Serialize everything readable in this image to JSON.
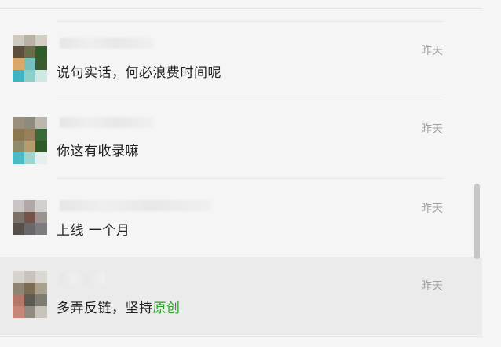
{
  "comments": [
    {
      "time": "昨天",
      "message": "说句实话，何必浪费时间呢",
      "avatar_colors": [
        "#cfcac0",
        "#b9b3a6",
        "#d3cfc4",
        "#5c4f3c",
        "#6a6d4a",
        "#2f5e2a",
        "#d8a96a",
        "#73c0bd",
        "#3c5a2f",
        "#3fb3c3",
        "#8cd0cb",
        "#cfe8e4"
      ]
    },
    {
      "time": "昨天",
      "message": "你这有收录嘛",
      "avatar_colors": [
        "#9a8f7e",
        "#8f8a7f",
        "#bdb6ac",
        "#8a7650",
        "#977f5c",
        "#3a6a3a",
        "#8e8a6c",
        "#b59c6d",
        "#2f5b2a",
        "#4bbac6",
        "#9fd4cf",
        "#e6efee"
      ]
    },
    {
      "time": "昨天",
      "message": "上线  一个月",
      "avatar_colors": [
        "#c9c5c4",
        "#b0a7a6",
        "#d2cfcf",
        "#7b7068",
        "#74534a",
        "#9a9390",
        "#55504c",
        "#6b6669",
        "#7d7a82",
        "#3d3d45",
        "#585566",
        "#8f8d97"
      ]
    },
    {
      "time": "昨天",
      "message": "多弄反链，坚持",
      "message_link": "原创",
      "avatar_colors": [
        "#d6d2cc",
        "#c9c3bb",
        "#dbd8d3",
        "#8f8374",
        "#7b6b55",
        "#a7a08e",
        "#b57868",
        "#5d5a52",
        "#7e7b70",
        "#c8857a",
        "#908a80",
        "#c7c2ba"
      ]
    }
  ]
}
